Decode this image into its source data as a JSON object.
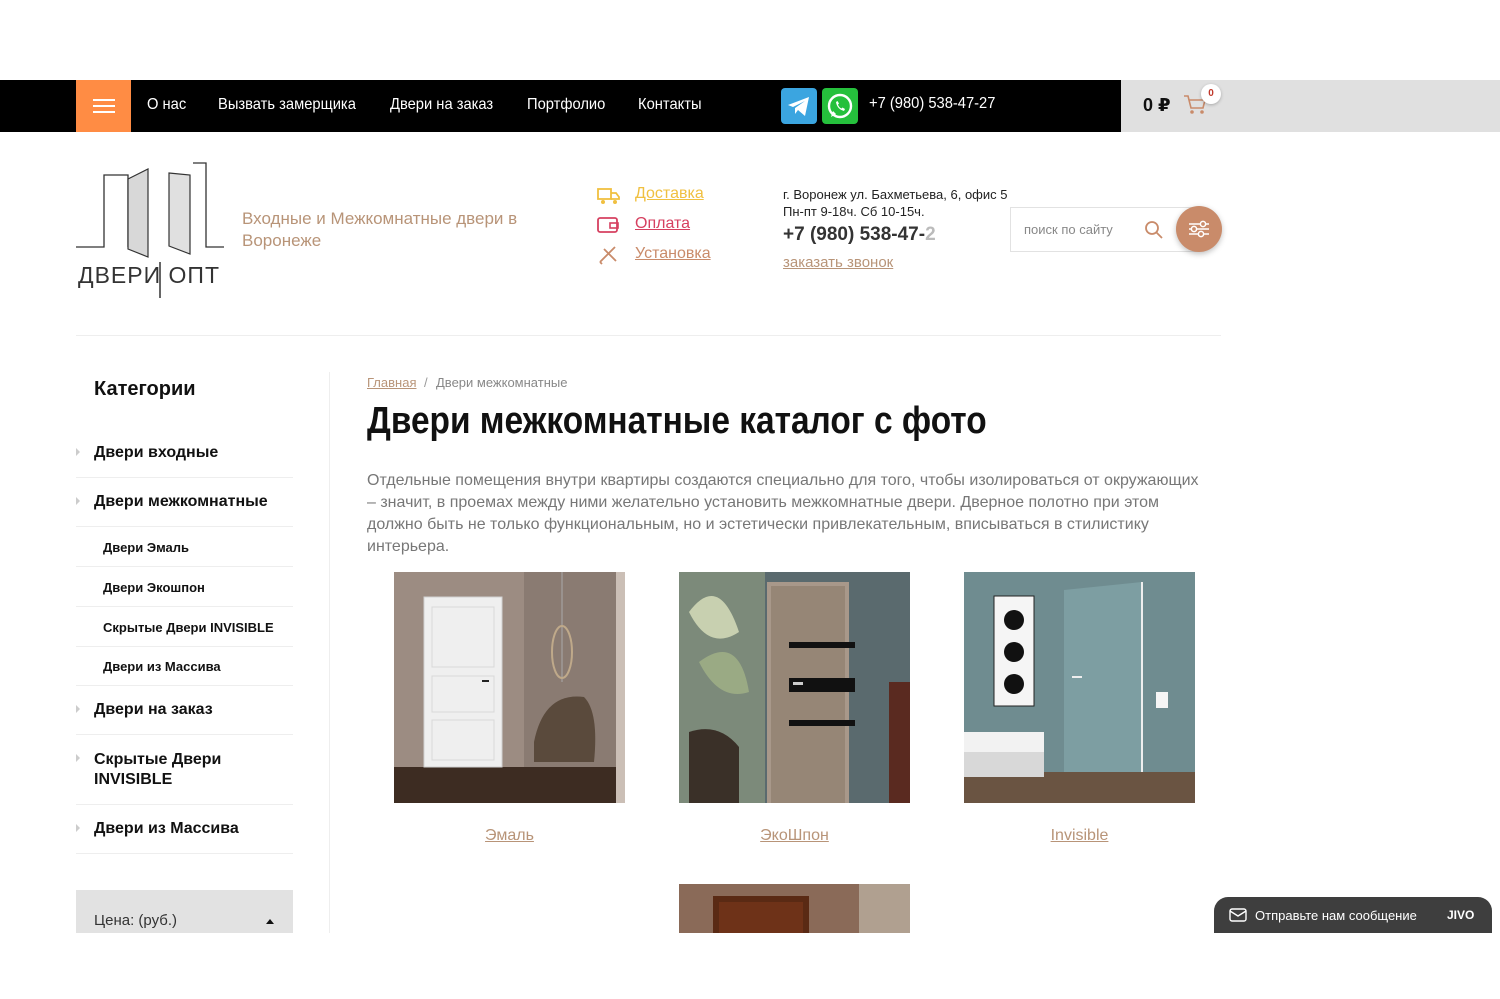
{
  "topbar": {
    "nav": [
      "О нас",
      "Вызвать замерщика",
      "Двери на заказ",
      "Портфолио",
      "Контакты"
    ],
    "phone": "+7 (980) 538-47-27",
    "cart_sum": "0 ₽",
    "cart_count": "0",
    "colors": {
      "accent": "#ff8c44",
      "bar": "#000000",
      "cart_area": "#e0e0e0"
    }
  },
  "header": {
    "logo_text": "ДВЕРИ ОПТ",
    "tagline": "Входные и Межкомнатные двери в Воронеже",
    "links": [
      {
        "label": "Доставка",
        "icon": "truck-icon",
        "color": "#f0c040"
      },
      {
        "label": "Оплата",
        "icon": "wallet-icon",
        "color": "#d64060"
      },
      {
        "label": "Установка",
        "icon": "tools-icon",
        "color": "#c98b6a"
      }
    ],
    "address_line1": "г. Воронеж ул. Бахметьева, 6, офис 5",
    "address_line2": "Пн-пт 9-18ч. Сб 10-15ч.",
    "phone_main": "+7 (980) 538-47-",
    "phone_fade": "2",
    "callback": "заказать звонок",
    "search_placeholder": "поиск по сайту"
  },
  "sidebar": {
    "title": "Категории",
    "items": [
      {
        "label": "Двери входные",
        "level": 1
      },
      {
        "label": "Двери межкомнатные",
        "level": 1
      },
      {
        "label": "Двери Эмаль",
        "level": 2
      },
      {
        "label": "Двери Экошпон",
        "level": 2
      },
      {
        "label": "Скрытые Двери INVISIBLE",
        "level": 2
      },
      {
        "label": "Двери из Массива",
        "level": 2
      },
      {
        "label": "Двери на заказ",
        "level": 1
      },
      {
        "label": "Скрытые Двери INVISIBLE",
        "level": 1
      },
      {
        "label": "Двери из Массива",
        "level": 1
      }
    ],
    "price_filter": "Цена: (руб.)"
  },
  "main": {
    "breadcrumb_home": "Главная",
    "breadcrumb_sep": "/",
    "breadcrumb_current": "Двери межкомнатные",
    "title": "Двери межкомнатные каталог с фото",
    "intro": "Отдельные помещения внутри квартиры создаются специально для того, чтобы изолироваться от окружающих – значит, в проемах между ними желательно установить межкомнатные двери. Дверное полотно при этом должно быть не только функциональным, но и эстетически привлекательным, вписываться в стилистику интерьера.",
    "cards": [
      {
        "caption": "Эмаль"
      },
      {
        "caption": "ЭкоШпон"
      },
      {
        "caption": "Invisible"
      }
    ]
  },
  "chat": {
    "text": "Отправьте нам сообщение",
    "brand": "JIVO"
  }
}
